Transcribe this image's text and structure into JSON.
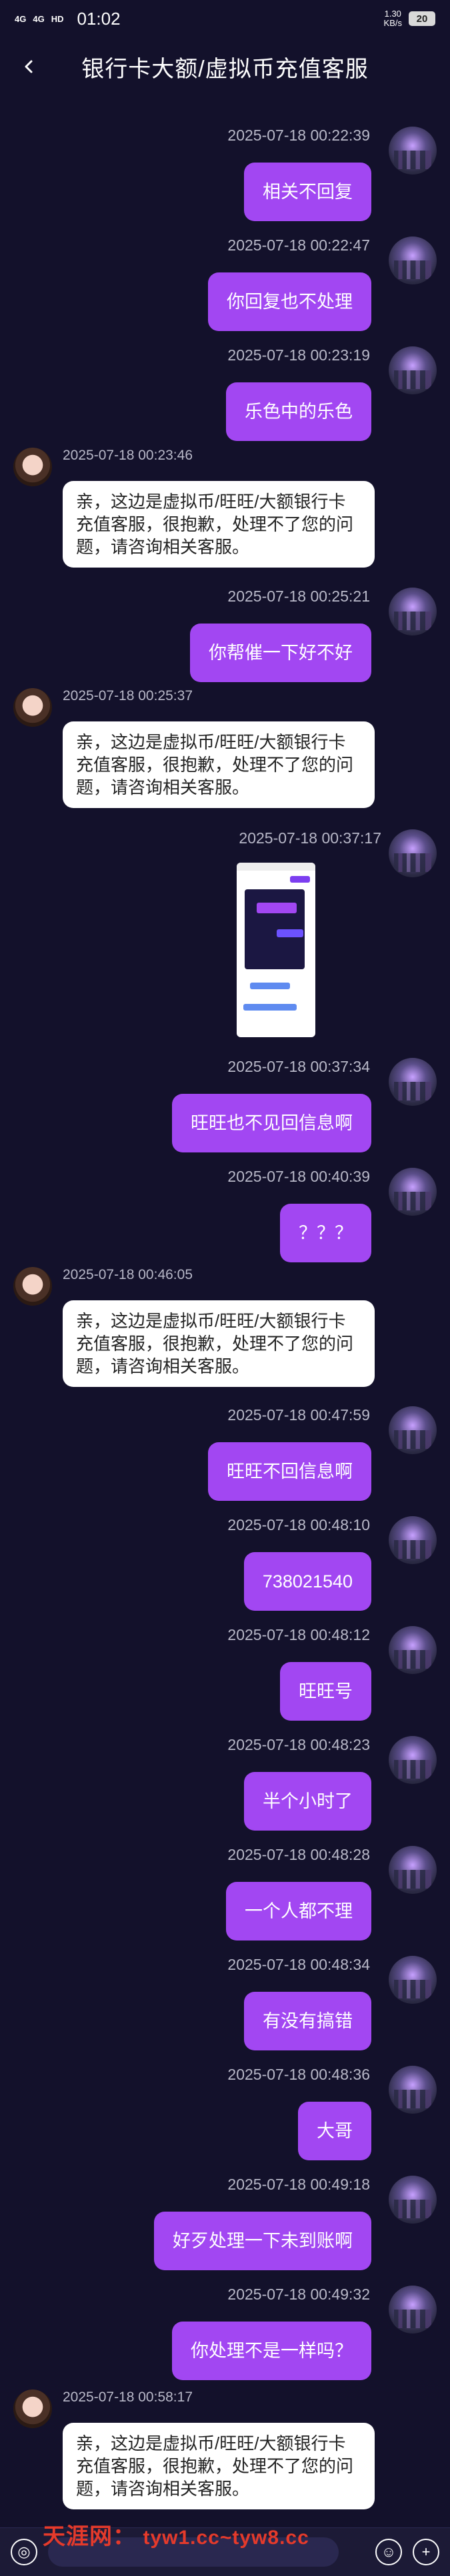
{
  "status_bar": {
    "network_1": "4G",
    "network_2": "4G",
    "hd_badge": "HD",
    "time": "01:02",
    "speed": "1.30\nKB/s",
    "battery": "20"
  },
  "header": {
    "title": "银行卡大额/虚拟币充值客服"
  },
  "messages": [
    {
      "side": "right",
      "timestamp": "2025-07-18 00:22:39",
      "text": "相关不回复"
    },
    {
      "side": "right",
      "timestamp": "2025-07-18 00:22:47",
      "text": "你回复也不处理"
    },
    {
      "side": "right",
      "timestamp": "2025-07-18 00:23:19",
      "text": "乐色中的乐色"
    },
    {
      "side": "left",
      "timestamp": "2025-07-18 00:23:46",
      "text": "亲，这边是虚拟币/旺旺/大额银行卡充值客服，很抱歉，处理不了您的问题，请咨询相关客服。"
    },
    {
      "side": "right",
      "timestamp": "2025-07-18 00:25:21",
      "text": "你帮催一下好不好"
    },
    {
      "side": "left",
      "timestamp": "2025-07-18 00:25:37",
      "text": "亲，这边是虚拟币/旺旺/大额银行卡充值客服，很抱歉，处理不了您的问题，请咨询相关客服。"
    },
    {
      "side": "right",
      "timestamp": "2025-07-18 00:37:17",
      "text": ""
    },
    {
      "side": "right",
      "timestamp": "2025-07-18 00:37:34",
      "text": "旺旺也不见回信息啊"
    },
    {
      "side": "right",
      "timestamp": "2025-07-18 00:40:39",
      "text": "？？？"
    },
    {
      "side": "left",
      "timestamp": "2025-07-18 00:46:05",
      "text": "亲，这边是虚拟币/旺旺/大额银行卡充值客服，很抱歉，处理不了您的问题，请咨询相关客服。"
    },
    {
      "side": "right",
      "timestamp": "2025-07-18 00:47:59",
      "text": "旺旺不回信息啊"
    },
    {
      "side": "right",
      "timestamp": "2025-07-18 00:48:10",
      "text": "738021540"
    },
    {
      "side": "right",
      "timestamp": "2025-07-18 00:48:12",
      "text": "旺旺号"
    },
    {
      "side": "right",
      "timestamp": "2025-07-18 00:48:23",
      "text": "半个小时了"
    },
    {
      "side": "right",
      "timestamp": "2025-07-18 00:48:28",
      "text": "一个人都不理"
    },
    {
      "side": "right",
      "timestamp": "2025-07-18 00:48:34",
      "text": "有没有搞错"
    },
    {
      "side": "right",
      "timestamp": "2025-07-18 00:48:36",
      "text": "大哥"
    },
    {
      "side": "right",
      "timestamp": "2025-07-18 00:49:18",
      "text": "好歹处理一下未到账啊"
    },
    {
      "side": "right",
      "timestamp": "2025-07-18 00:49:32",
      "text": "你处理不是一样吗？"
    },
    {
      "side": "left",
      "timestamp": "2025-07-18 00:58:17",
      "text": "亲，这边是虚拟币/旺旺/大额银行卡充值客服，很抱歉，处理不了您的问题，请咨询相关客服。"
    }
  ],
  "footer": {
    "watermark": "天涯网：",
    "watermark_url": "tyw1.cc~tyw8.cc"
  },
  "icons": {
    "back": "chevron-left-icon",
    "voice": "voice-icon",
    "emoji": "emoji-icon",
    "plus": "plus-icon"
  },
  "colors": {
    "background": "#13112b",
    "user_bubble": "#a247f2",
    "agent_bubble": "#ffffff",
    "timestamp": "#b9b9c9"
  }
}
